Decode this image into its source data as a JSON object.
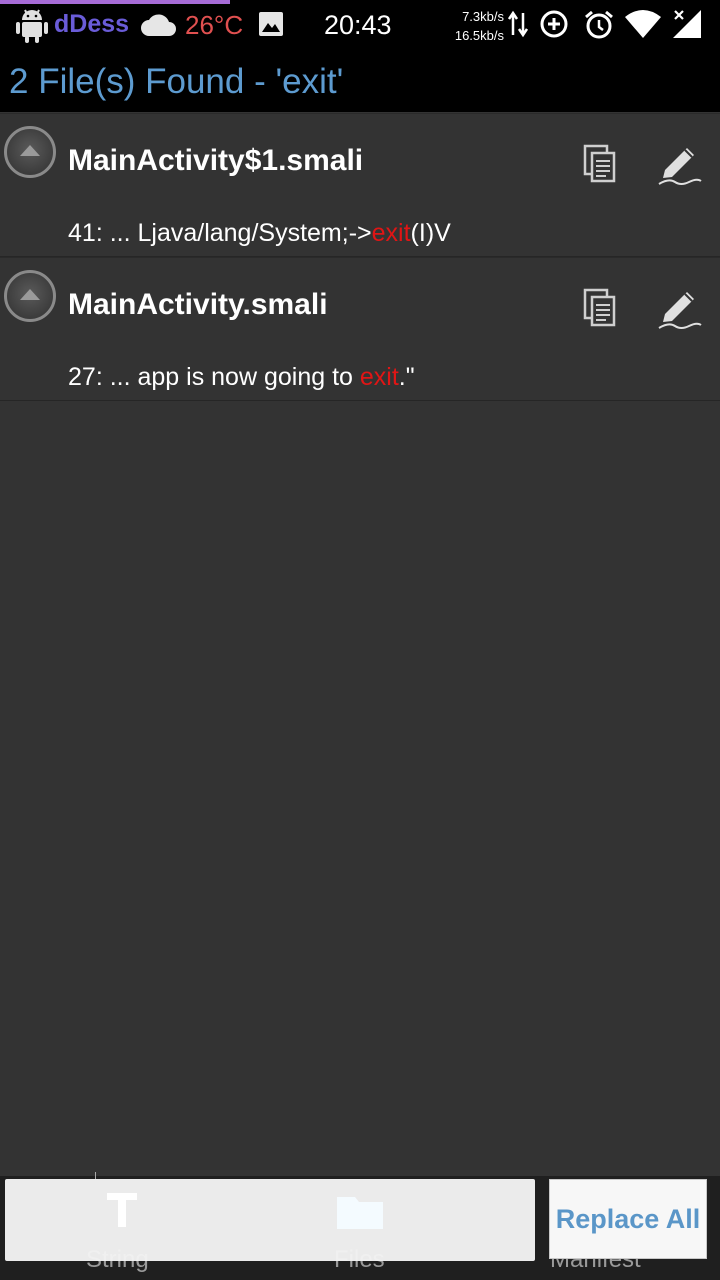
{
  "status_bar": {
    "app_name": "dDess",
    "temperature": "26°C",
    "time": "20:43",
    "upload_speed": "7.3kb/s",
    "download_speed": "16.5kb/s",
    "icons": [
      "android-icon",
      "cloud-icon",
      "image-icon",
      "data-arrows-icon",
      "data-saver-icon",
      "alarm-icon",
      "wifi-icon",
      "signal-icon"
    ]
  },
  "header": {
    "title": "2 File(s) Found - 'exit'"
  },
  "results": [
    {
      "file": "MainActivity$1.smali",
      "match": {
        "line": "41",
        "before": ": ... Ljava/lang/System;->",
        "term": "exit",
        "after": "(I)V"
      }
    },
    {
      "file": "MainActivity.smali",
      "match": {
        "line": "27",
        "before": ": ... app is now going to ",
        "term": "exit",
        "after": ".\""
      }
    }
  ],
  "bottom_tabs": [
    "String",
    "Files",
    "Manifest"
  ],
  "actions": {
    "replace_all": "Replace All"
  },
  "colors": {
    "accent": "#5d9bd0",
    "highlight": "#e01515",
    "background": "#333333"
  }
}
